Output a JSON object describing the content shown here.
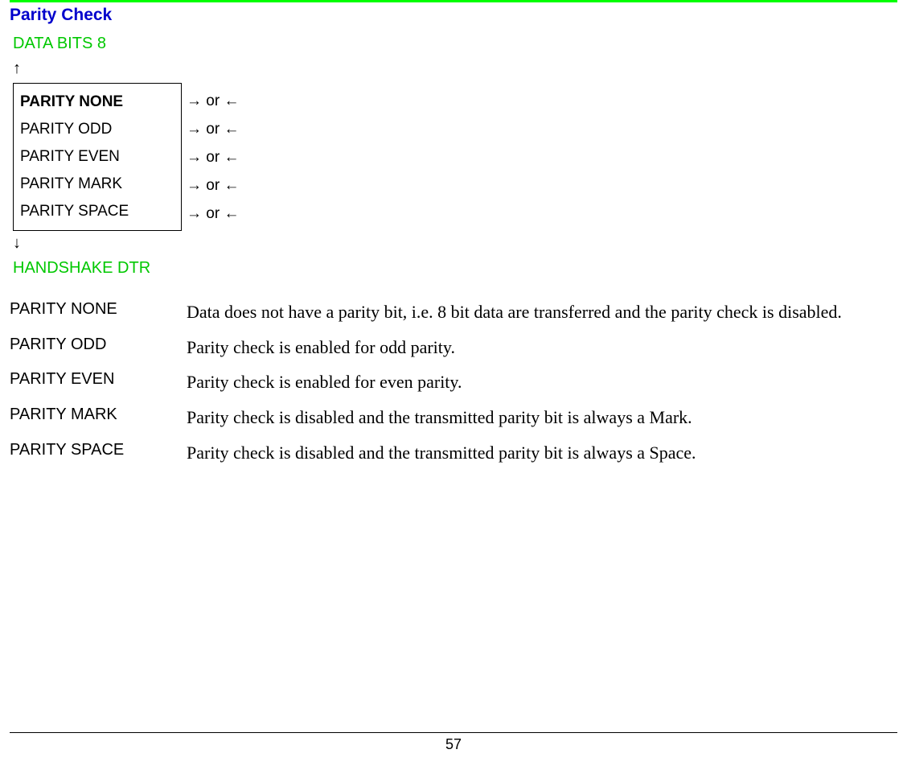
{
  "section_title": "Parity Check",
  "nav": {
    "prev": "DATA BITS 8",
    "up_arrow": "↑",
    "down_arrow": "↓",
    "next": "HANDSHAKE DTR",
    "side_hint": "→ or ←"
  },
  "menu": {
    "items": [
      {
        "label": "PARITY NONE",
        "selected": true
      },
      {
        "label": "PARITY ODD",
        "selected": false
      },
      {
        "label": "PARITY EVEN",
        "selected": false
      },
      {
        "label": "PARITY MARK",
        "selected": false
      },
      {
        "label": "PARITY SPACE",
        "selected": false
      }
    ]
  },
  "definitions": [
    {
      "term": "PARITY NONE",
      "desc": "Data does not have a parity bit, i.e. 8 bit data are transferred and the parity check is disabled."
    },
    {
      "term": "PARITY ODD",
      "desc": "Parity check is enabled for odd parity."
    },
    {
      "term": "PARITY EVEN",
      "desc": "Parity check is enabled for even parity."
    },
    {
      "term": "PARITY MARK",
      "desc": "Parity check is disabled and the transmitted parity bit is always a Mark."
    },
    {
      "term": "PARITY SPACE",
      "desc": "Parity check is disabled and the transmitted parity bit is always a Space."
    }
  ],
  "page_number": "57"
}
